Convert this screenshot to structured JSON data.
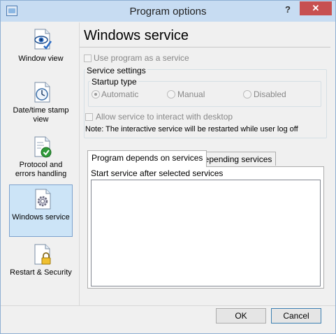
{
  "window": {
    "title": "Program options",
    "help_symbol": "?",
    "close_symbol": "✕"
  },
  "sidebar": {
    "items": [
      {
        "label": "Window view",
        "icon": "window-view-icon",
        "selected": false
      },
      {
        "label": "Date/time stamp view",
        "icon": "clock-icon",
        "selected": false
      },
      {
        "label": "Protocol and errors handling",
        "icon": "check-document-icon",
        "selected": false
      },
      {
        "label": "Windows service",
        "icon": "gear-document-icon",
        "selected": true
      },
      {
        "label": "Restart & Security",
        "icon": "lock-document-icon",
        "selected": false
      }
    ]
  },
  "main": {
    "page_title": "Windows service",
    "use_as_service_label": "Use program as a service",
    "service_settings_label": "Service settings",
    "startup_type_label": "Startup type",
    "startup_options": [
      "Automatic",
      "Manual",
      "Disabled"
    ],
    "startup_selected": "Automatic",
    "interact_desktop_label": "Allow service to interact with desktop",
    "note_text": "Note: The interactive service will be restarted while user log off",
    "tabs": [
      {
        "label": "Program depends on services",
        "active": true
      },
      {
        "label": "Depending services",
        "active": false
      }
    ],
    "list_caption": "Start service after selected services"
  },
  "footer": {
    "ok_label": "OK",
    "cancel_label": "Cancel"
  },
  "colors": {
    "titlebar": "#c7dcf2",
    "close_button": "#c75050",
    "selection": "#cce4f7"
  }
}
